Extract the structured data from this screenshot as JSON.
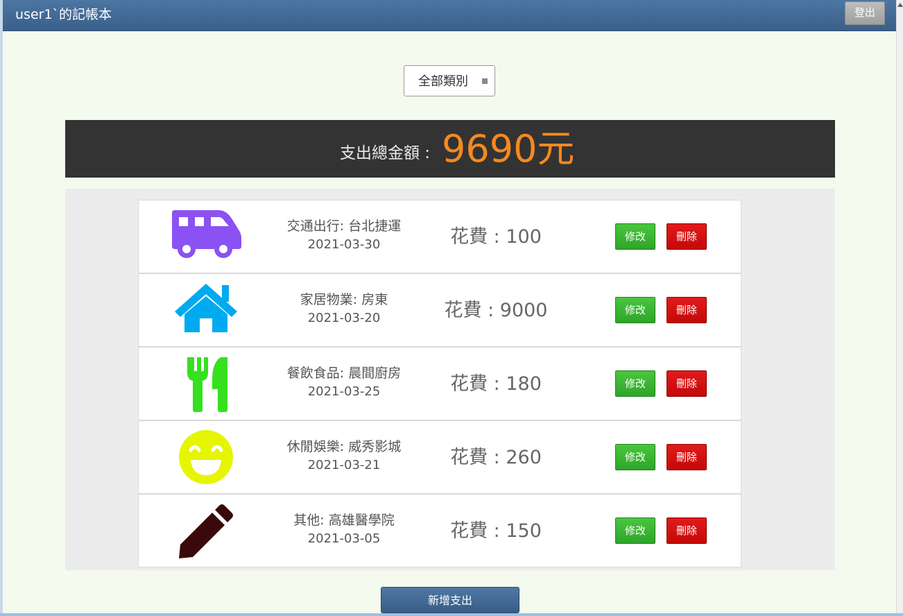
{
  "header": {
    "title": "user1`的記帳本",
    "logout_label": "登出"
  },
  "filter": {
    "selected": "全部類別"
  },
  "summary": {
    "label": "支出總金額 :",
    "amount": "9690元"
  },
  "actions": {
    "edit_label": "修改",
    "delete_label": "刪除",
    "add_label": "新增支出"
  },
  "expenses": [
    {
      "name": "交通出行: 台北捷運",
      "date": "2021-03-30",
      "cost": "花費 : 100",
      "icon": "bus-icon",
      "color": "#8a52f2"
    },
    {
      "name": "家居物業: 房東",
      "date": "2021-03-20",
      "cost": "花費 : 9000",
      "icon": "house-icon",
      "color": "#00aaf0"
    },
    {
      "name": "餐飲食品: 晨間廚房",
      "date": "2021-03-25",
      "cost": "花費 : 180",
      "icon": "utensils-icon",
      "color": "#36e01e"
    },
    {
      "name": "休閒娛樂: 威秀影城",
      "date": "2021-03-21",
      "cost": "花費 : 260",
      "icon": "smiley-icon",
      "color": "#e6f500"
    },
    {
      "name": "其他: 高雄醫學院",
      "date": "2021-03-05",
      "cost": "花費 : 150",
      "icon": "pencil-icon",
      "color": "#3a0a0a"
    }
  ],
  "colors": {
    "header": "#3f648d",
    "total_bar": "#333333",
    "total_amount": "#f5891f",
    "edit": "#3bb535",
    "delete": "#d40f0f"
  }
}
